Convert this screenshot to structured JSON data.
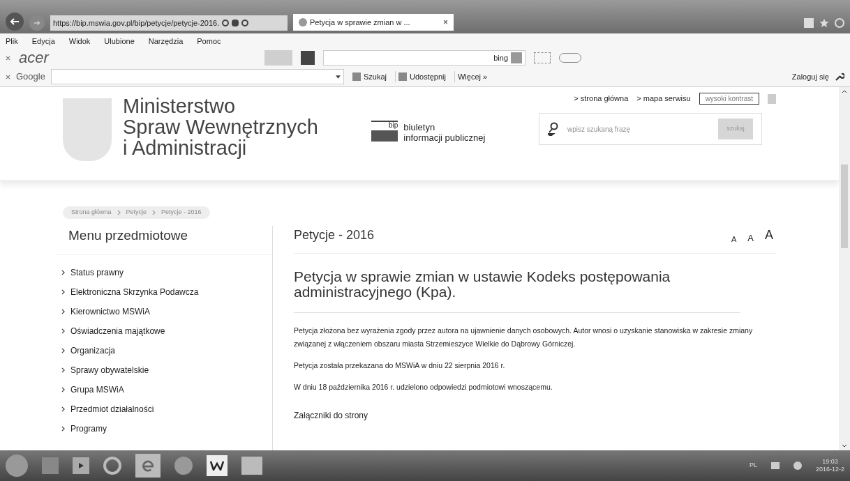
{
  "browser": {
    "address": "https://bip.mswia.gov.pl/bip/petycje/petycje-2016.",
    "tab": {
      "label": "Petycja w sprawie zmian w ...",
      "close": "×",
      "selected": true
    },
    "menu": [
      "Plik",
      "Edycja",
      "Widok",
      "Ulubione",
      "Narzędzia",
      "Pomoc"
    ],
    "acer_toolbar": {
      "logo": "acer",
      "search_brand": "bing"
    },
    "google_toolbar": {
      "logo": "Google",
      "search": "Szukaj",
      "share": "Udostępnij",
      "more": "Więcej »",
      "login": "Zaloguj się"
    }
  },
  "site": {
    "title_lines": [
      "Ministerstwo",
      "Spraw Wewnętrznych",
      "i Administracji"
    ],
    "top_links": [
      "> strona główna",
      "> mapa serwisu"
    ],
    "contrast_button": "wysoki kontrast",
    "bip": {
      "mark": "bip",
      "lines": [
        "biuletyn",
        "informacji publicznej"
      ]
    },
    "search": {
      "placeholder": "wpisz szukaną frazę",
      "button": "szukaj"
    }
  },
  "breadcrumb": [
    "Strona główna",
    "Petycje",
    "Petycje - 2016"
  ],
  "sidebar": {
    "heading": "Menu przedmiotowe",
    "items": [
      {
        "label": "Status prawny"
      },
      {
        "label": "Elektroniczna Skrzynka Podawcza"
      },
      {
        "label": "Kierownictwo MSWiA"
      },
      {
        "label": "Oświadczenia majątkowe"
      },
      {
        "label": "Organizacja"
      },
      {
        "label": "Sprawy obywatelskie"
      },
      {
        "label": "Grupa MSWiA"
      },
      {
        "label": "Przedmiot działalności"
      },
      {
        "label": "Programy"
      }
    ]
  },
  "content": {
    "section": "Petycje - 2016",
    "font_sizes": [
      "A",
      "A",
      "A"
    ],
    "title": "Petycja w sprawie zmian w ustawie Kodeks postępowania administracyjnego (Kpa).",
    "paragraphs": [
      "Petycja złożona bez wyrażenia zgody przez autora na ujawnienie danych osobowych. Autor wnosi o uzyskanie stanowiska w zakresie zmiany związanej z włączeniem obszaru miasta Strzemieszyce Wielkie do Dąbrowy Górniczej.",
      "Petycja została przekazana do MSWiA w dniu 22 sierpnia 2016 r.",
      "W dniu 18 października 2016 r. udzielono odpowiedzi podmiotowi wnoszącemu."
    ],
    "attachments": "Załączniki do strony"
  },
  "taskbar": {
    "language": "PL",
    "time": "19:03",
    "date": "2016-12-2"
  }
}
